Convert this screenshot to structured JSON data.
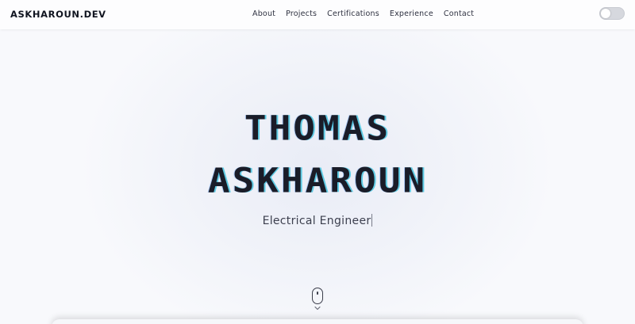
{
  "navbar": {
    "logo": "ASKHAROUN.DEV",
    "links": [
      {
        "label": "About"
      },
      {
        "label": "Projects"
      },
      {
        "label": "Certifications"
      },
      {
        "label": "Experience"
      },
      {
        "label": "Contact"
      }
    ],
    "theme_toggle": {
      "state": "off",
      "icon": "theme-toggle-icon"
    }
  },
  "hero": {
    "name_line1": "THOMAS",
    "name_line2": "ASKHAROUN",
    "subtitle": "Electrical Engineer",
    "scroll_icon": "mouse-scroll-icon"
  },
  "colors": {
    "accent_glitch": "#2dbedc",
    "text_dark": "#1a1c28",
    "background": "#f1f3f9"
  }
}
